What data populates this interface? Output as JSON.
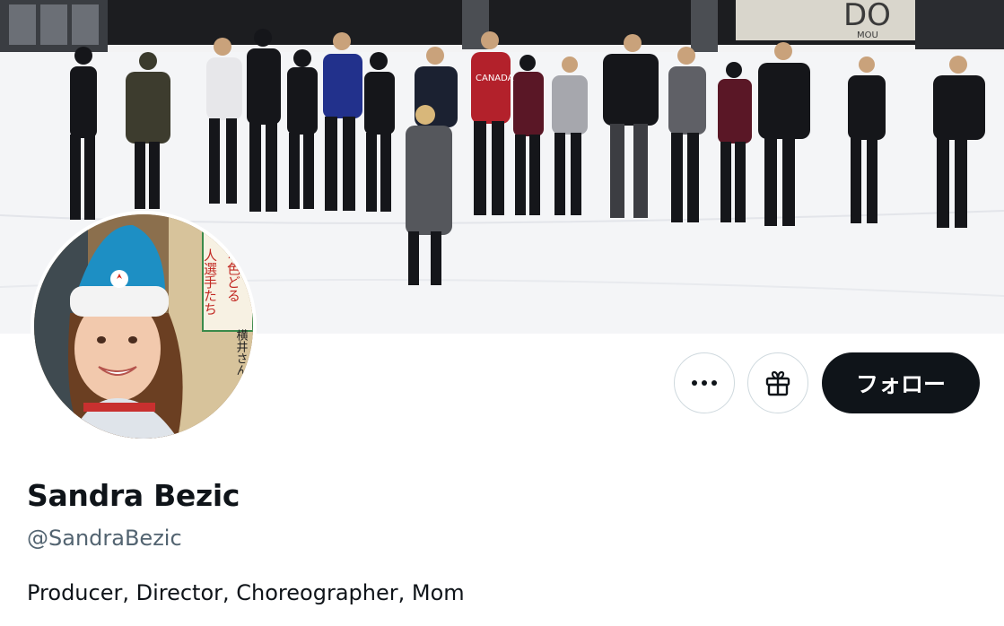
{
  "profile": {
    "display_name": "Sandra Bezic",
    "handle": "@SandraBezic",
    "bio": "Producer, Director, Choreographer, Mom"
  },
  "banner": {
    "description_icon": "banner-photo",
    "signage_text": "DO",
    "sub_signage": "MOU",
    "jersey_text": "CANADA"
  },
  "avatar": {
    "icon": "avatar-photo",
    "sign_lines": [
      "人選手たち",
      "な色どる"
    ],
    "sign_lines_2": [
      "横井さん"
    ]
  },
  "actions": {
    "more_icon": "more-dots-icon",
    "gift_icon": "gift-icon",
    "follow_label": "フォロー"
  },
  "colors": {
    "follow_bg": "#0f1419",
    "text_primary": "#0f1419",
    "text_secondary": "#536471",
    "border": "#cfd9de"
  }
}
